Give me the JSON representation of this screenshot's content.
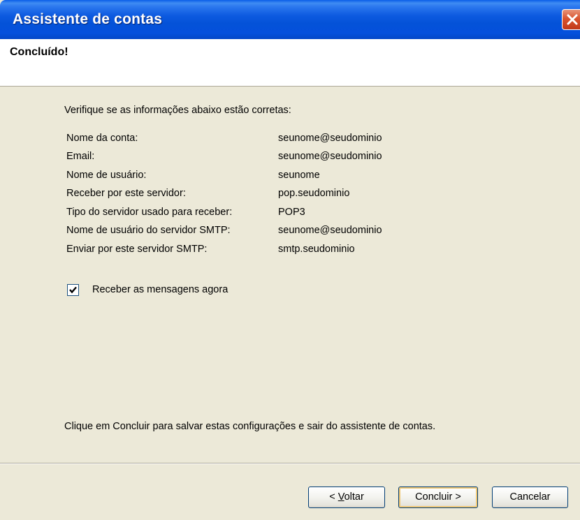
{
  "window": {
    "title": "Assistente de contas"
  },
  "header": {
    "title": "Concluído!"
  },
  "body": {
    "intro": "Verifique se as informações abaixo estão corretas:",
    "summary": [
      {
        "label": "Nome da conta:",
        "value": "seunome@seudominio"
      },
      {
        "label": "Email:",
        "value": "seunome@seudominio"
      },
      {
        "label": "Nome de usuário:",
        "value": "seunome"
      },
      {
        "label": "Receber por este servidor:",
        "value": "pop.seudominio"
      },
      {
        "label": "Tipo do servidor usado para receber:",
        "value": "POP3"
      },
      {
        "label": "Nome de usuário do servidor SMTP:",
        "value": "seunome@seudominio"
      },
      {
        "label": "Enviar por este servidor SMTP:",
        "value": "smtp.seudominio"
      }
    ],
    "checkbox": {
      "label": "Receber as mensagens agora",
      "checked": true
    },
    "footer_note": "Clique em Concluir para salvar estas configurações e sair do assistente de contas."
  },
  "buttons": {
    "back_prefix": "< ",
    "back_mnemonic": "V",
    "back_rest": "oltar",
    "finish": "Concluir >",
    "cancel": "Cancelar"
  },
  "icons": {
    "close": "close-icon",
    "check": "checkmark-icon"
  },
  "colors": {
    "titlebar": "#0452d8",
    "dialog_bg": "#ece9d8",
    "close_button": "#d9542f",
    "default_button_focus": "#f0c876"
  }
}
